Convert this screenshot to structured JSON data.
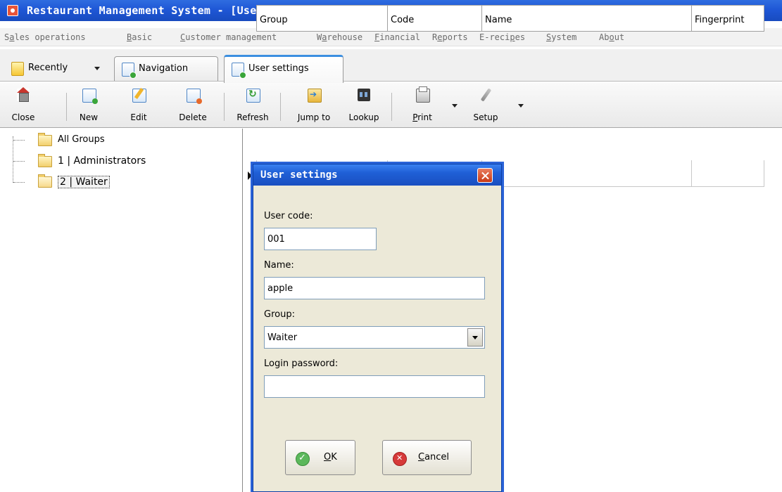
{
  "window": {
    "title": "Restaurant Management System - [User settings]"
  },
  "menu": {
    "items": [
      {
        "pre": "S",
        "ul": "a",
        "post": "les operations"
      },
      {
        "pre": "",
        "ul": "B",
        "post": "asic"
      },
      {
        "pre": "",
        "ul": "C",
        "post": "ustomer management"
      },
      {
        "pre": "W",
        "ul": "a",
        "post": "rehouse"
      },
      {
        "pre": "",
        "ul": "F",
        "post": "inancial"
      },
      {
        "pre": "R",
        "ul": "e",
        "post": "ports"
      },
      {
        "pre": "E-reci",
        "ul": "p",
        "post": "es"
      },
      {
        "pre": "",
        "ul": "S",
        "post": "ystem"
      },
      {
        "pre": "Ab",
        "ul": "o",
        "post": "ut"
      }
    ]
  },
  "tabs": {
    "recently": "Recently",
    "navigation": "Navigation",
    "user_settings": "User settings"
  },
  "toolbar": {
    "close": "Close",
    "new": "New",
    "edit": "Edit",
    "delete": "Delete",
    "refresh": "Refresh",
    "jump_to": "Jump to",
    "lookup": "Lookup",
    "print_ul": "P",
    "print_rest": "rint",
    "setup": "Setup"
  },
  "tree": {
    "items": [
      "All Groups",
      "1 | Administrators",
      "2 | Waiter"
    ]
  },
  "grid": {
    "columns": [
      "Group",
      "Code",
      "Name",
      "Fingerprint"
    ]
  },
  "dialog": {
    "title": "User settings",
    "user_code_label": "User code:",
    "user_code_value": "001",
    "name_label": "Name:",
    "name_value": "apple",
    "group_label": "Group:",
    "group_value": "Waiter",
    "password_label": "Login password:",
    "password_value": "",
    "ok_ul": "O",
    "ok_rest": "K",
    "cancel_ul": "C",
    "cancel_rest": "ancel"
  }
}
